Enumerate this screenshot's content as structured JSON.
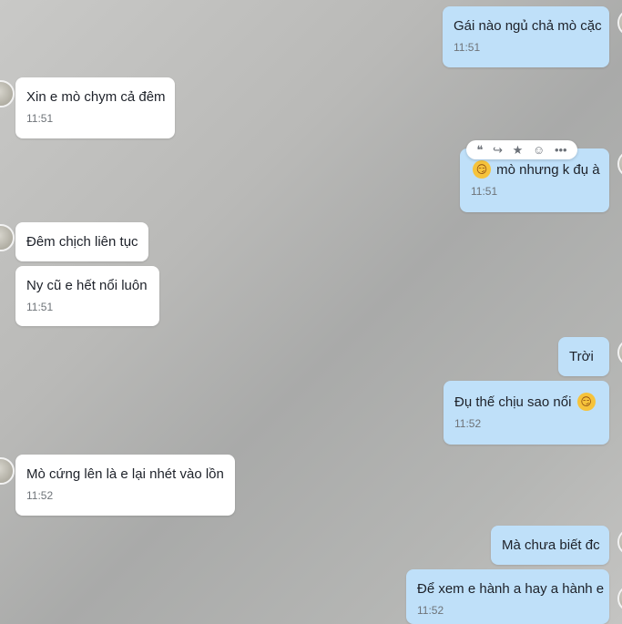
{
  "messages": [
    {
      "text": "Gái nào ngủ chả mò cặc",
      "time": "11:51"
    },
    {
      "text": "Xin e mò chym cả đêm",
      "time": "11:51"
    },
    {
      "text": "mò nhưng k đụ à",
      "time": "11:51",
      "emoji": "smirk-face"
    },
    {
      "text": "Đêm chịch liên tục"
    },
    {
      "text": "Ny cũ e hết nổi luôn",
      "time": "11:51"
    },
    {
      "text": "Trời"
    },
    {
      "text": "Đụ thế chịu sao nổi",
      "time": "11:52",
      "emoji": "smirk-face"
    },
    {
      "text": "Mò cứng lên là e lại nhét vào lồn",
      "time": "11:52"
    },
    {
      "text": "Mà chưa biết đc"
    },
    {
      "text": "Để xem e hành a hay a hành e",
      "time": "11:52"
    }
  ],
  "toolbar": {
    "quote": "❝",
    "forward": "↪",
    "star": "★",
    "react": "☺",
    "more": "•••"
  },
  "emoji_glyph": "😏",
  "colors": {
    "incoming": "#ffffff",
    "outgoing": "#bfe0f9"
  }
}
